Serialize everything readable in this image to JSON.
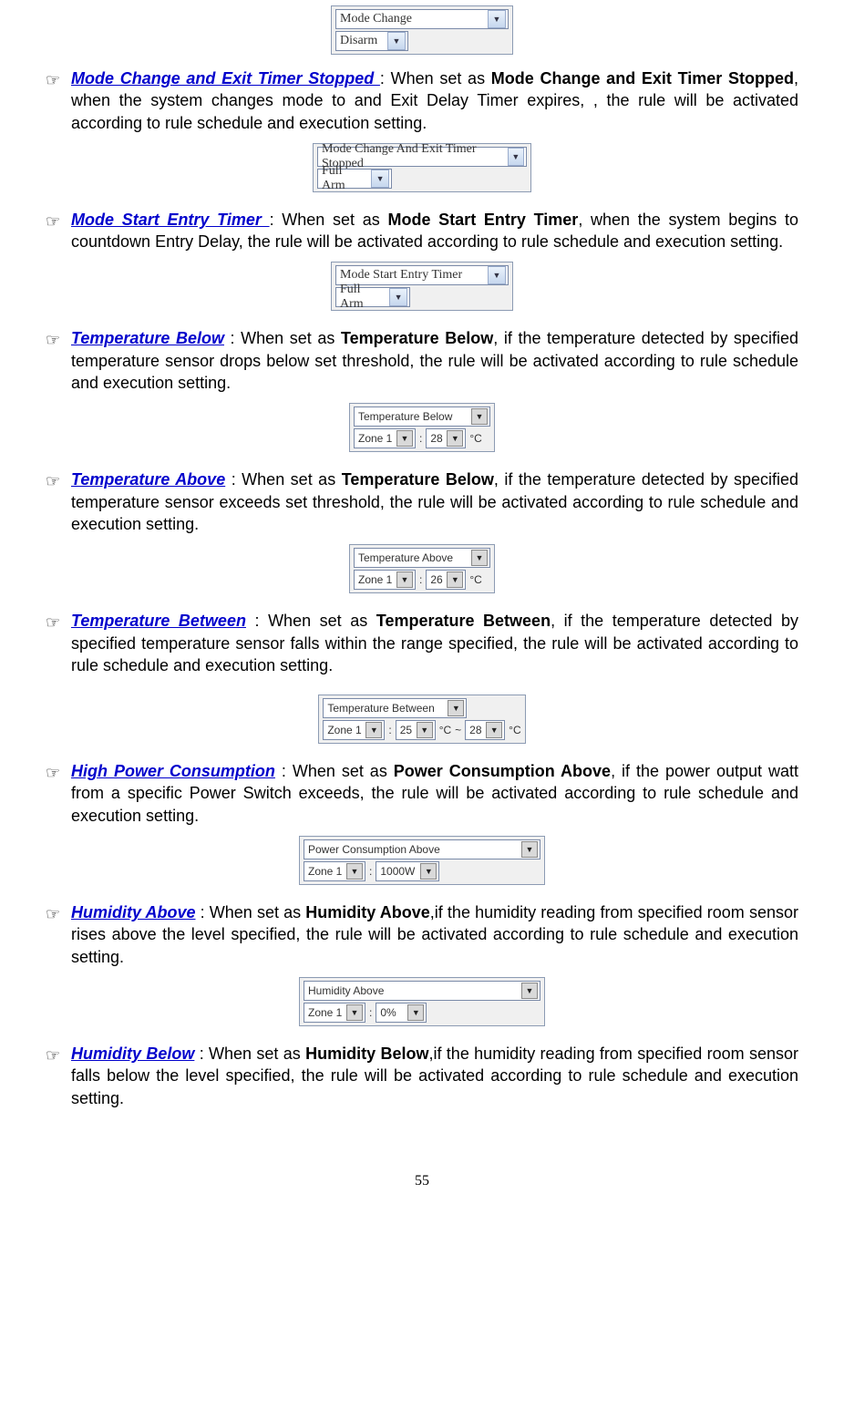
{
  "pageNumber": "55",
  "bullet": "☞",
  "ctrl0": {
    "row1": "Mode Change",
    "row2": "Disarm"
  },
  "sec1": {
    "title": "Mode Change and Exit Timer Stopped ",
    "body1": ": When set as ",
    "bold1": "Mode Change and Exit Timer Stopped",
    "body2": ", when the system changes mode to and Exit Delay Timer expires, , the rule will be activated according to rule schedule and execution setting.",
    "ctrl": {
      "row1": "Mode Change And Exit Timer Stopped",
      "row2": "Full Arm"
    }
  },
  "sec2": {
    "title": "Mode Start Entry Timer ",
    "body1": ": When set as ",
    "bold1": "Mode Start Entry Timer",
    "body2": ", when the system begins to countdown Entry Delay, the rule will be activated according to rule schedule and execution setting.",
    "ctrl": {
      "row1": "Mode Start Entry Timer",
      "row2": "Full Arm"
    }
  },
  "sec3": {
    "title": "Temperature Below",
    "body1": " : When set as ",
    "bold1": "Temperature Below",
    "body2": ", if the temperature detected by specified temperature sensor drops below set threshold, the rule will be activated according to rule schedule and execution setting.",
    "ctrl": {
      "type": "Temperature Below",
      "zone": "Zone 1",
      "val": "28",
      "unit": "°C"
    }
  },
  "sec4": {
    "title": "Temperature Above",
    "body1": " : When set as ",
    "bold1": "Temperature Below",
    "body2": ", if the temperature detected by specified temperature sensor exceeds set threshold, the rule will be activated according to rule schedule and execution setting.",
    "ctrl": {
      "type": "Temperature Above",
      "zone": "Zone 1",
      "val": "26",
      "unit": "°C"
    }
  },
  "sec5": {
    "title": "Temperature Between",
    "body1": " : When set as ",
    "bold1": "Temperature Between",
    "body2": ", if the temperature detected by specified temperature sensor falls within the range specified, the rule will be activated according to rule schedule and execution setting.",
    "ctrl": {
      "type": "Temperature Between",
      "zone": "Zone 1",
      "val1": "25",
      "val2": "28",
      "unit": "°C"
    }
  },
  "sec6": {
    "title": "High Power Consumption",
    "body1": " : When set as ",
    "bold1": "Power Consumption Above",
    "body2": ", if the power output watt from a specific Power Switch exceeds, the rule will be activated according to rule schedule and execution setting.",
    "ctrl": {
      "type": "Power Consumption Above",
      "zone": "Zone 1",
      "val": "1000W"
    }
  },
  "sec7": {
    "title": "Humidity Above",
    "body1": " : When set as ",
    "bold1": "Humidity Above",
    "body2": ",if the humidity reading from specified room sensor rises above the level specified, the rule will be activated according to rule schedule and execution setting.",
    "ctrl": {
      "type": "Humidity Above",
      "zone": "Zone 1",
      "val": "0%"
    }
  },
  "sec8": {
    "title": "Humidity Below",
    "body1": " : When set as ",
    "bold1": "Humidity Below",
    "body2": ",if the humidity reading from specified room sensor falls below the level specified, the rule will be activated according to rule schedule and execution setting."
  }
}
